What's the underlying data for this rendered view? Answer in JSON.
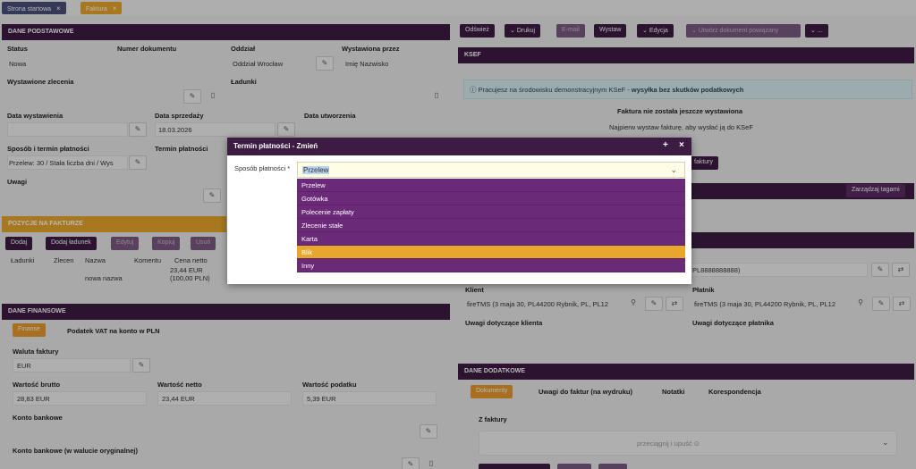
{
  "tabs": [
    {
      "label": "Strona startowa",
      "close": "×"
    },
    {
      "label": "Faktura",
      "close": "×"
    }
  ],
  "dane_podstawowe": {
    "title": "DANE PODSTAWOWE",
    "status_label": "Status",
    "status_value": "Nowa",
    "numer_label": "Numer dokumentu",
    "oddzial_label": "Oddział",
    "oddzial_value": "Oddział Wrocław",
    "wystawiona_label": "Wystawiona przez",
    "wystawiona_value": "Imię Nazwisko",
    "zlecenia_label": "Wystawione zlecenia",
    "ladunki_label": "Ładunki",
    "data_wyst_label": "Data wystawienia",
    "data_sprz_label": "Data sprzedaży",
    "data_sprz_value": "18.03.2026",
    "data_utw_label": "Data utworzenia",
    "sposob_label": "Sposób i termin płatności",
    "sposob_value": "Przelew: 30 / Stała liczba dni / Wys",
    "termin_label": "Termin płatności",
    "uwagi_label": "Uwagi"
  },
  "pozycje": {
    "title": "POZYCJE NA FAKTURZE",
    "buttons": [
      "Dodaj",
      "Dodaj ładunek",
      "Edytuj",
      "Kopiuj",
      "Usuń"
    ],
    "cols": [
      "Ładunki",
      "Zlecen",
      "Nazwa",
      "Komentu",
      "Cena netto"
    ],
    "row_nazwa": "nowa nazwa",
    "row_cena": "23,44 EUR (100,00 PLN)"
  },
  "dane_finansowe": {
    "title": "DANE FINANSOWE",
    "finanse_btn": "Finanse",
    "vat_label": "Podatek VAT na konto w PLN",
    "waluta_label": "Waluta faktury",
    "waluta_value": "EUR",
    "brutto_label": "Wartość brutto",
    "brutto_value": "28,83 EUR",
    "netto_label": "Wartość netto",
    "netto_value": "23,44 EUR",
    "podatek_label": "Wartość podatku",
    "podatek_value": "5,39 EUR",
    "konto_label": "Konto bankowe",
    "konto_oryg_label": "Konto bankowe (w walucie oryginalnej)"
  },
  "toolbar": {
    "odswiez": "Odśwież",
    "drukuj": "Drukuj",
    "email": "E-mail",
    "wystaw": "Wystaw",
    "edycja": "Edycja",
    "utworz": "Utwórz dokument powiązany",
    "more": "..."
  },
  "ksef": {
    "title": "KSEF",
    "info_plain": "Pracujesz na środowisku demonstracyjnym KSeF - ",
    "info_bold": "wysyłka bez skutków podatkowych",
    "status": "Faktura nie została jeszcze wystawiona",
    "hint": "Najpierw wystaw fakturę, aby wysłać ją do KSeF",
    "button": "faktury"
  },
  "tagi_btn": "Zarządzaj tagami",
  "kontrahent": {
    "nip_value": "PL8888888888)",
    "klient_label": "Klient",
    "klient_value": "fireTMS (3 maja 30, PL44200 Rybnik, PL, PL12",
    "platnik_label": "Płatnik",
    "platnik_value": "fireTMS (3 maja 30, PL44200 Rybnik, PL, PL12",
    "uwagi_klient": "Uwagi dotyczące klienta",
    "uwagi_platnik": "Uwagi dotyczące płatnika"
  },
  "dane_dodatkowe": {
    "title": "DANE DODATKOWE",
    "tabs": [
      "Dokumenty",
      "Uwagi do faktur (na wydruku)",
      "Notatki",
      "Korespondencja"
    ],
    "z_faktury": "Z faktury",
    "dropzone": "przeciągnij i upuść ⊙"
  },
  "modal": {
    "title": "Termin płatności - Zmień",
    "plus": "+",
    "close": "×",
    "field_label": "Sposób płatności *",
    "selected": "Przelew",
    "options": [
      "Przelew",
      "Gotówka",
      "Polecenie zapłaty",
      "Zlecenie stałe",
      "Karta",
      "Blik",
      "Inny"
    ],
    "highlighted": "Blik"
  },
  "colors": {
    "primary": "#3d1c44",
    "dropdown": "#6a2a78",
    "highlight": "#e8a72c",
    "accent": "#e89a2b"
  },
  "icons": [
    "edit-icon",
    "copy-icon",
    "file-icon",
    "swap-icon",
    "link-icon",
    "chevron-down-icon",
    "info-icon",
    "close-icon",
    "plus-icon"
  ]
}
